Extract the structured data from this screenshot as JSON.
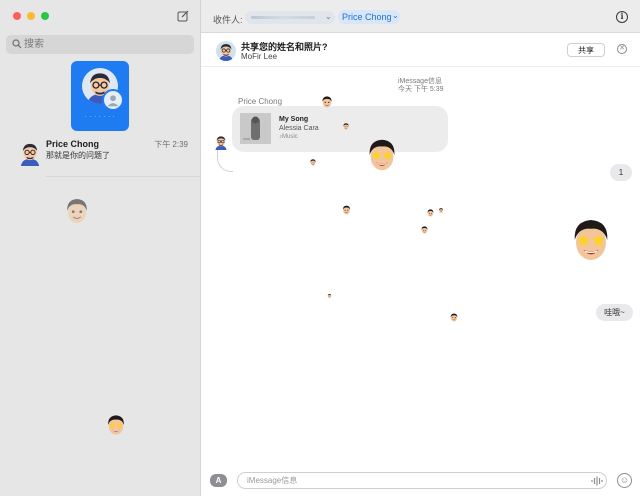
{
  "sidebar": {
    "search_placeholder": "搜索",
    "conversations": [
      {
        "name": "Price Chong",
        "time": "下午 2:39",
        "preview": "那就是你的问题了"
      }
    ]
  },
  "header": {
    "to_label": "收件人:",
    "recipient": "Price Chong"
  },
  "share_banner": {
    "title": "共享您的姓名和照片?",
    "name": "MoFir Lee",
    "share_button": "共享"
  },
  "thread": {
    "service": "iMessage信息",
    "timestamp": "今天 下午 5:39",
    "sender": "Price Chong",
    "song": {
      "title": "My Song",
      "artist": "Alessia Cara",
      "source": "Music"
    },
    "outgoing": [
      "1",
      "哇哦~"
    ]
  },
  "composer": {
    "placeholder": "iMessage信息"
  },
  "colors": {
    "accent": "#1e7bf2",
    "sidebar_bg": "#e6e6e6",
    "bubble_gray": "#e9e9eb"
  },
  "icons": [
    "compose-icon",
    "search-icon",
    "info-icon",
    "close-icon",
    "apps-icon",
    "audio-wave-icon",
    "emoji-icon",
    "music-icon"
  ]
}
